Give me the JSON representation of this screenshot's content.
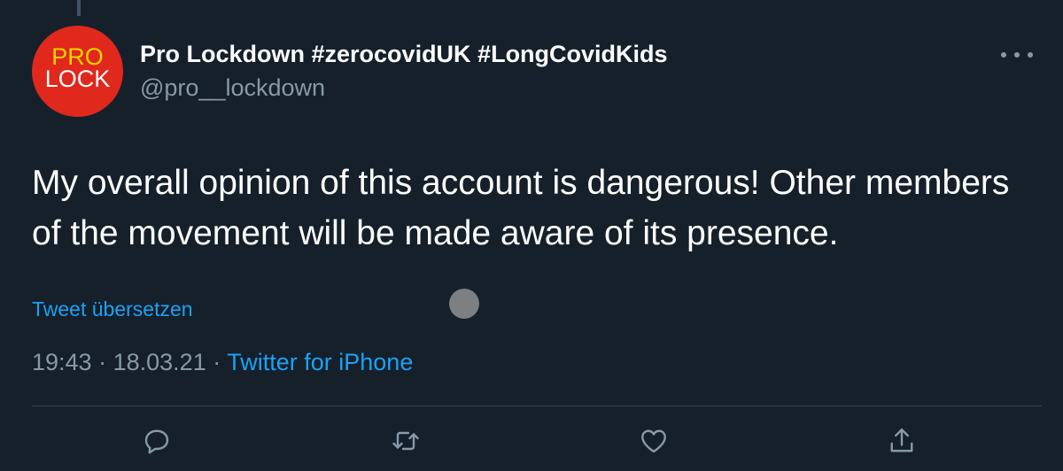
{
  "author": {
    "display_name": "Pro Lockdown #zerocovidUK #LongCovidKids",
    "handle": "@pro__lockdown",
    "avatar_logo": {
      "line1": "PRO",
      "line2": "LOCK",
      "line1_color": "#f5d400",
      "line2_color": "#ffffff",
      "background": "#e0281c"
    }
  },
  "tweet": {
    "text": "My overall opinion of this account is dangerous! Other members of the movement will be made aware of its presence.",
    "translate_label": "Tweet übersetzen",
    "time": "19:43",
    "separator": "·",
    "date": "18.03.21",
    "source": "Twitter for iPhone"
  },
  "actions": [
    {
      "name": "reply",
      "icon": "reply-icon"
    },
    {
      "name": "retweet",
      "icon": "retweet-icon"
    },
    {
      "name": "like",
      "icon": "heart-icon"
    },
    {
      "name": "share",
      "icon": "share-icon"
    }
  ],
  "colors": {
    "background": "#15202b",
    "primary_text": "#ffffff",
    "secondary_text": "#8899a6",
    "accent": "#1da1f2",
    "divider": "#38444d"
  }
}
